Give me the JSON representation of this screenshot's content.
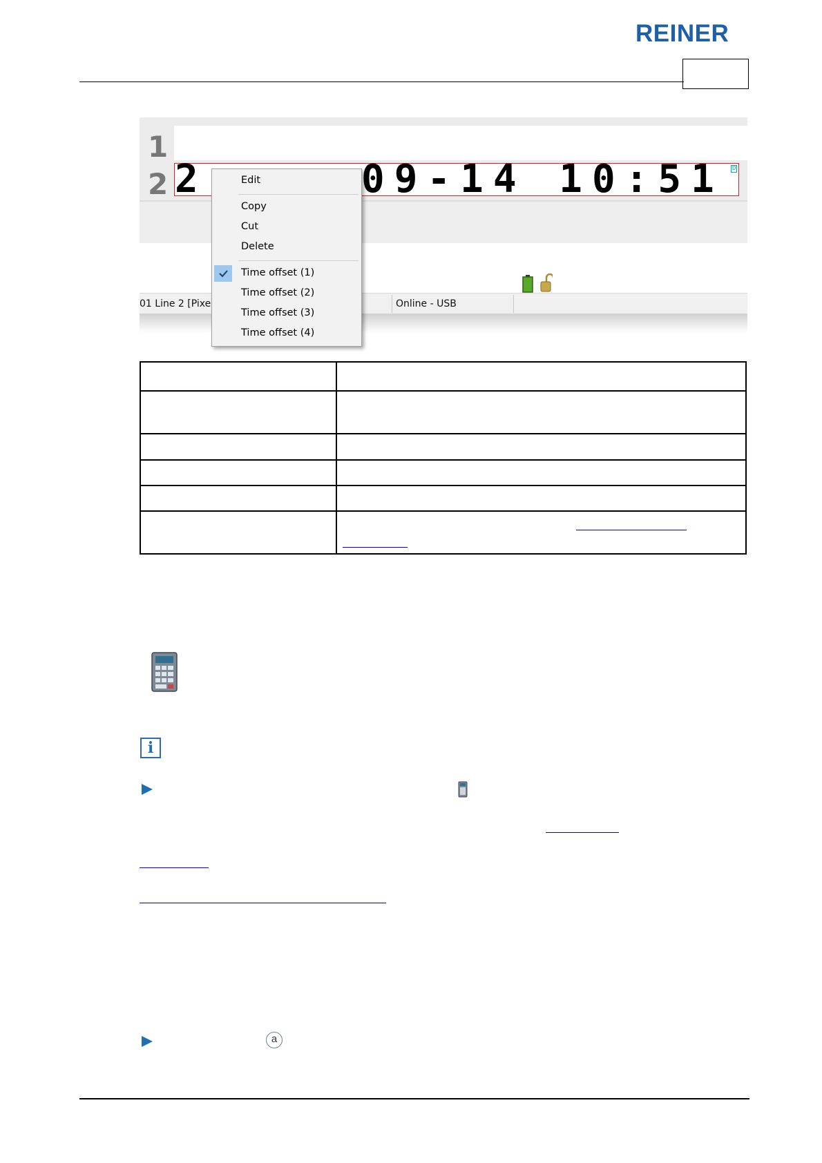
{
  "brand": {
    "logo_text": "REINER",
    "logo_color": "#1f5fa6"
  },
  "screenshot": {
    "line_numbers": [
      "1",
      "2"
    ],
    "line2_text": "2",
    "line2_text_right": "09-14 10:51",
    "line2_marker": "D",
    "context_menu": {
      "items": [
        {
          "label": "Edit",
          "checked": false
        },
        {
          "label": "Copy",
          "checked": false
        },
        {
          "label": "Cut",
          "checked": false
        },
        {
          "label": "Delete",
          "checked": false
        },
        {
          "label": "Time offset (1)",
          "checked": true
        },
        {
          "label": "Time offset (2)",
          "checked": false
        },
        {
          "label": "Time offset (3)",
          "checked": false
        },
        {
          "label": "Time offset (4)",
          "checked": false
        }
      ]
    },
    "status_bar": {
      "position_text": "01 Line 2 [Pixel]",
      "connection_text": "Online - USB"
    },
    "status_icons": [
      "battery-icon",
      "padlock-open-icon"
    ]
  },
  "icons": {
    "calculator": "calculator-icon",
    "info": "info-icon",
    "info_glyph": "i",
    "bullet": "arrow-bullet-icon",
    "circle_a_glyph": "a"
  },
  "colors": {
    "accent": "#1f6fb5",
    "link": "#0000ee",
    "menu_check_bg": "#9ec7ef",
    "field_border": "#dd2222"
  }
}
